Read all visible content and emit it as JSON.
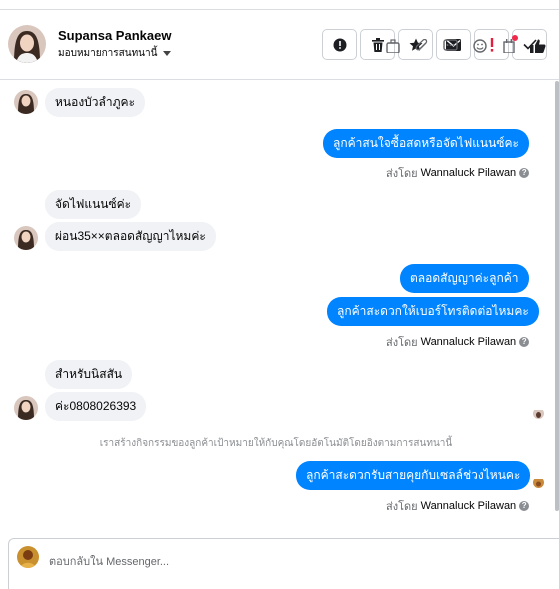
{
  "header": {
    "contact_name": "Supansa Pankaew",
    "assign_label": "มอบหมายการสนทนานี้"
  },
  "actions": [
    "info-icon",
    "trash-icon",
    "star-icon",
    "envelope-icon",
    "exclamation-icon",
    "check-icon"
  ],
  "messages": [
    {
      "dir": "in",
      "text": "หนองบัวลำภูคะ"
    },
    {
      "dir": "out",
      "text": "ลูกค้าสนใจซื้อสดหรือจัดไฟแนนซ์คะ"
    },
    {
      "dir": "in",
      "text": "จัดไฟแนนซ์ค่ะ"
    },
    {
      "dir": "in",
      "text": "ผ่อน35××ตลอดสัญญาไหมค่ะ"
    },
    {
      "dir": "out",
      "text": "ตลอดสัญญาค่ะลูกค้า"
    },
    {
      "dir": "out",
      "text": "ลูกค้าสะดวกให้เบอร์โทรติดต่อไหมคะ"
    },
    {
      "dir": "in",
      "text": "สำหรับนิสสัน"
    },
    {
      "dir": "in",
      "text": "ค่ะ0808026393"
    },
    {
      "dir": "out",
      "text": "ลูกค้าสะดวกรับสายคุยกับเซลล์ช่วงไหนคะ"
    }
  ],
  "sent_by": {
    "prefix": "ส่งโดย",
    "name": "Wannaluck Pilawan"
  },
  "notice": "เราสร้างกิจกรรมของลูกค้าเป้าหมายให้กับคุณโดยอัตโนมัติโดยอิงตามการสนทนานี้",
  "composer": {
    "placeholder": "ตอบกลับใน Messenger..."
  },
  "colors": {
    "outgoing": "#0084ff",
    "incoming": "#f0f2f5",
    "danger": "#e41e3f"
  }
}
